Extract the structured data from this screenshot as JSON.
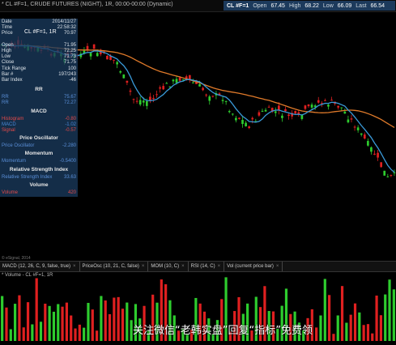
{
  "header": {
    "title": "* CL #F=1, CRUDE FUTURES (NIGHT), 1R, 00:00-00:00 (Dynamic)",
    "symbol": "CL #F=1",
    "open_label": "Open",
    "open": "67.45",
    "high_label": "High",
    "high": "68.22",
    "low_label": "Low",
    "low": "66.09",
    "last_label": "Last",
    "last": "66.54"
  },
  "inline_label": "CL #F=1, 1R",
  "panel": {
    "rows": [
      {
        "k": "Date",
        "v": "2014/11/27"
      },
      {
        "k": "Time",
        "v": "22:58:32"
      },
      {
        "k": "Price",
        "v": "70.97"
      },
      {
        "k": "",
        "v": ""
      },
      {
        "k": "Open",
        "v": "71.95"
      },
      {
        "k": "High",
        "v": "72.25"
      },
      {
        "k": "Low",
        "v": "71.73"
      },
      {
        "k": "Close",
        "v": "71.75"
      },
      {
        "k": "Tick Range",
        "v": "100"
      },
      {
        "k": "Bar #",
        "v": "197/243"
      },
      {
        "k": "Bar Index",
        "v": "-46"
      }
    ],
    "sections": [
      {
        "title": "RR",
        "rows": [
          {
            "k": "RR",
            "v": "75.67"
          },
          {
            "k": "RR",
            "v": "72.27"
          }
        ]
      },
      {
        "title": "MACD",
        "rows": [
          {
            "k": "Histogram",
            "v": "-0.80"
          },
          {
            "k": "MACD",
            "v": "-1.02"
          },
          {
            "k": "Signal",
            "v": "-0.57"
          }
        ]
      },
      {
        "title": "Price Oscillator",
        "rows": [
          {
            "k": "Price Oscillator",
            "v": "-2.280"
          }
        ]
      },
      {
        "title": "Momentum",
        "rows": [
          {
            "k": "Momentum",
            "v": "-0.5400"
          }
        ]
      },
      {
        "title": "Relative Strength Index",
        "rows": [
          {
            "k": "Relative Strength Index",
            "v": "33.63"
          }
        ]
      },
      {
        "title": "Volume",
        "rows": [
          {
            "k": "Volume",
            "v": "420"
          }
        ]
      }
    ]
  },
  "tabs": [
    {
      "label": "MACD (12, 26, C, 9, false, true)"
    },
    {
      "label": "PriceOsc (10, 21, C, false)"
    },
    {
      "label": "MOM (10, C)"
    },
    {
      "label": "RSI (14, C)"
    },
    {
      "label": "Vol (current price bar)"
    }
  ],
  "tab_close": "×",
  "volume_label": "* Volume - CL #F=1, 1R",
  "copyright": "© eSignal, 2014",
  "watermark": "关注微信“老韩实盘”回复“指标”免费领",
  "colors": {
    "up": "#2ecc2e",
    "down": "#e02020",
    "ma_fast": "#3a9ad9",
    "ma_slow": "#e07a2a"
  }
}
